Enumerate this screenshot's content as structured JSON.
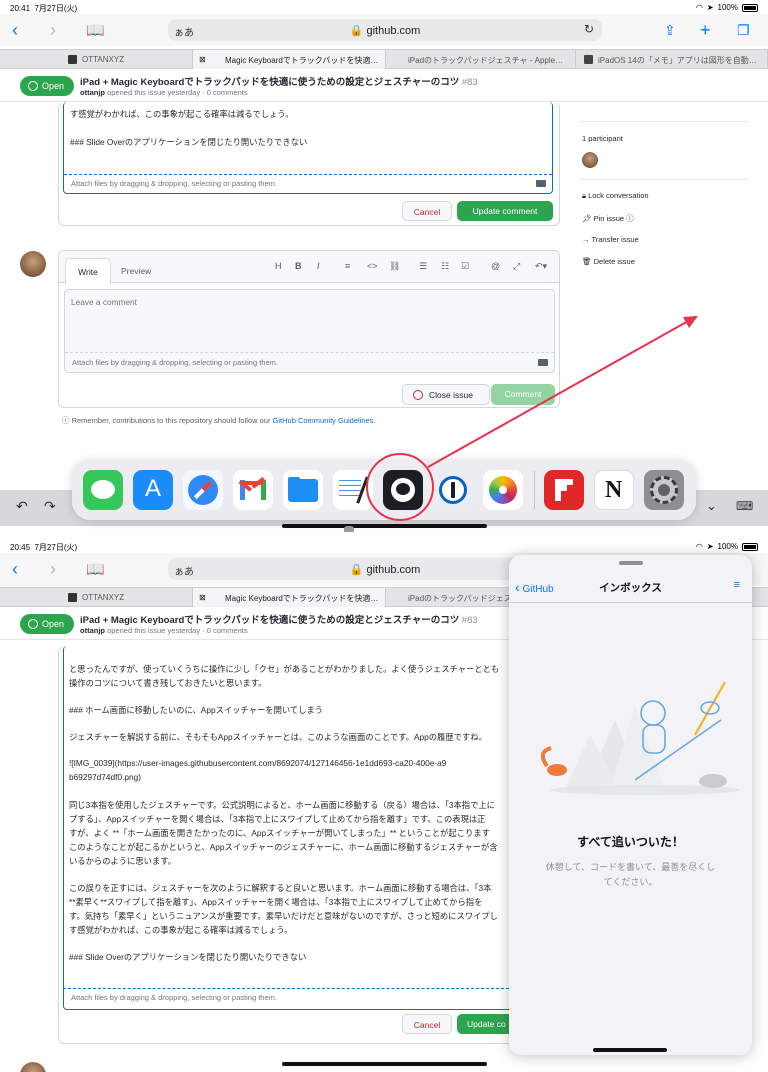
{
  "top": {
    "status": {
      "time": "20:41",
      "date": "7月27日(火)",
      "battery": "100%"
    },
    "safari": {
      "aa": "ぁあ",
      "url": "github.com"
    },
    "tabs": [
      "OTTANXYZ",
      "Magic Keyboardでトラックパッドを快適…",
      "iPadのトラックパッドジェスチャ - Apple…",
      "iPadOS 14の「メモ」アプリは図形を自動…"
    ],
    "issue": {
      "badge": "Open",
      "title": "iPad + Magic Keyboardでトラックパッドを快適に使うための設定とジェスチャーのコツ",
      "number": "#83",
      "author": "ottanjp",
      "meta": "opened this issue yesterday · 0 comments"
    },
    "editor_lines": [
      "す感覚がわかれば、この事象が起こる確率は減るでしょう。",
      "### Slide Overのアプリケーションを閉じたり開いたりできない"
    ],
    "attach": "Attach files by dragging & dropping, selecting or pasting them.",
    "cancel": "Cancel",
    "update": "Update comment",
    "write_tab": "Write",
    "preview_tab": "Preview",
    "comment_placeholder": "Leave a comment",
    "close_issue": "Close issue",
    "comment_btn": "Comment",
    "remember": "Remember, contributions to this repository should follow our",
    "guidelines": "GitHub Community Guidelines",
    "sidebar": {
      "participants": "1 participant",
      "lock": "Lock conversation",
      "pin": "Pin issue",
      "transfer": "Transfer issue",
      "delete": "Delete issue"
    }
  },
  "bottom": {
    "status": {
      "time": "20:45",
      "date": "7月27日(火)",
      "battery": "100%"
    },
    "safari": {
      "aa": "ぁあ",
      "url": "github.com"
    },
    "tabs": [
      "OTTANXYZ",
      "Magic Keyboardでトラックパッドを快適…",
      "iPadのトラックパッドジェスチャ"
    ],
    "issue": {
      "badge": "Open",
      "title": "iPad + Magic Keyboardでトラックパッドを快適に使うための設定とジェスチャーのコツ",
      "number": "#83",
      "author": "ottanjp",
      "meta": "opened this issue yesterday · 0 comments"
    },
    "doc_lines": [
      "と思ったんですが、使っていくうちに操作に少し「クセ」があることがわかりました。よく使うジェスチャーととも",
      "操作のコツについて書き残しておきたいと思います。",
      "",
      "### ホーム画面に移動したいのに、Appスイッチャーを開いてしまう",
      "",
      "ジェスチャーを解説する前に、そもそもAppスイッチャーとは、このような画面のことです。Appの履歴ですね。",
      "",
      "![IMG_0039](https://user-images.githubusercontent.com/8692074/127146456-1e1dd693-ca20-400e-a9",
      "b69297d74df0.png)",
      "",
      "同じ3本指を使用したジェスチャーです。公式説明によると、ホーム画面に移動する（戻る）場合は、「3本指で上に",
      "プする」、Appスイッチャーを開く場合は、「3本指で上にスワイプして止めてから指を離す」です。この表現は正",
      "すが、よく **「ホーム画面を開きたかったのに、Appスイッチャーが開いてしまった」** ということが起こります",
      "このようなことが起こるかというと、Appスイッチャーのジェスチャーに、ホーム画面に移動するジェスチャーが含",
      "いるからのように思います。",
      "",
      "この誤りを正すには、ジェスチャーを次のように解釈すると良いと思います。ホーム画面に移動する場合は、「3本",
      "**素早く**スワイプして指を離す」、Appスイッチャーを開く場合は、「3本指で上にスワイプして止めてから指を",
      "す。気持ち「素早く」というニュアンスが重要です。素早いだけだと意味がないのですが、さっと短めにスワイプし",
      "す感覚がわかれば、この事象が起こる確率は減るでしょう。",
      "",
      "### Slide Overのアプリケーションを閉じたり開いたりできない"
    ],
    "attach": "Attach files by dragging & dropping, selecting or pasting them.",
    "cancel": "Cancel",
    "update": "Update co",
    "panel": {
      "back": "GitHub",
      "title": "インボックス",
      "empty_title": "すべて追いついた！",
      "empty_body_1": "休憩して、コードを書いて、最善を尽くし",
      "empty_body_2": "てください。"
    }
  },
  "dock_apps": [
    "messages-icon",
    "app-store-icon",
    "safari-icon",
    "gmail-icon",
    "files-icon",
    "notes-pen-icon",
    "github-icon",
    "1password-icon",
    "photos-icon",
    "flipboard-icon",
    "notion-icon",
    "settings-icon"
  ],
  "colors": {
    "accent": "#007aff",
    "open_green": "#2da44e",
    "annotation_red": "#e8324a",
    "link_blue": "#0969da"
  }
}
